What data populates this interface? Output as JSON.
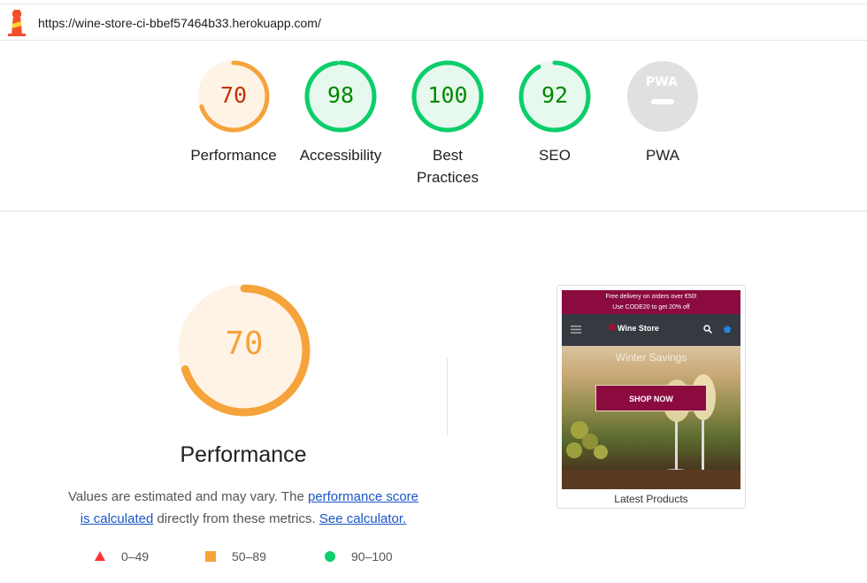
{
  "header": {
    "url": "https://wine-store-ci-bbef57464b33.herokuapp.com/"
  },
  "categories": [
    {
      "label": "Performance",
      "score": "70",
      "fraction": 0.7,
      "color": "#f5a33a",
      "text_color": "#c33300",
      "bg": "#fff3e6"
    },
    {
      "label": "Accessibility",
      "score": "98",
      "fraction": 0.98,
      "color": "#0cce6b",
      "text_color": "#008800",
      "bg": "#e7f9ee"
    },
    {
      "label": "Best\nPractices",
      "label_line1": "Best",
      "label_line2": "Practices",
      "score": "100",
      "fraction": 1.0,
      "color": "#0cce6b",
      "text_color": "#008800",
      "bg": "#e7f9ee"
    },
    {
      "label": "SEO",
      "score": "92",
      "fraction": 0.92,
      "color": "#0cce6b",
      "text_color": "#008800",
      "bg": "#e7f9ee"
    },
    {
      "label": "PWA",
      "badge": "PWA",
      "color": "#e0e0e0"
    }
  ],
  "performance": {
    "score": "70",
    "fraction": 0.7,
    "title": "Performance",
    "desc_prefix": "Values are estimated and may vary. The ",
    "desc_link1": "performance score is calculated",
    "desc_middle": " directly from these metrics. ",
    "desc_link2": "See calculator.",
    "legend": [
      {
        "range": "0–49",
        "color": "#ff3333",
        "shape": "triangle"
      },
      {
        "range": "50–89",
        "color": "#f5a33a",
        "shape": "square"
      },
      {
        "range": "90–100",
        "color": "#0cce6b",
        "shape": "circle"
      }
    ]
  },
  "thumbnail": {
    "promo_line1": "Free delivery on orders over €50!",
    "promo_line2": "Use CODE20 to get 20% off",
    "brand": "Wine Store",
    "hero_title": "Winter Savings",
    "hero_button": "SHOP NOW",
    "section_title": "Latest Products"
  }
}
